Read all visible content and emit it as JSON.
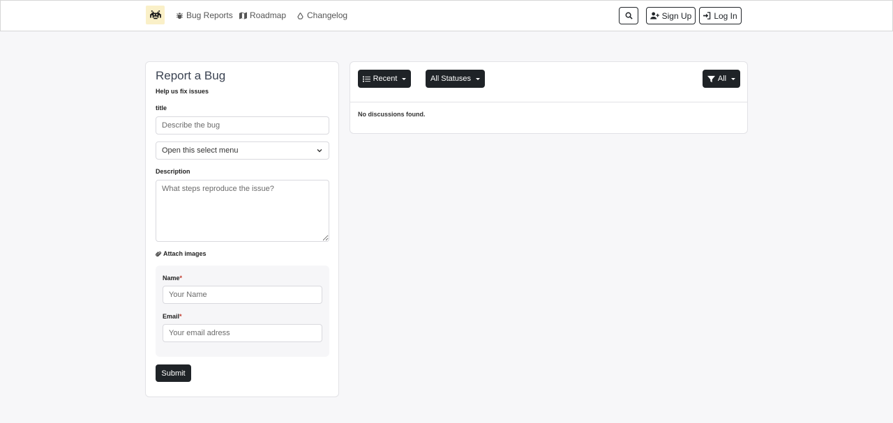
{
  "nav": {
    "links": [
      {
        "label": "Bug Reports",
        "icon": "bug-icon"
      },
      {
        "label": "Roadmap",
        "icon": "map-icon"
      },
      {
        "label": "Changelog",
        "icon": "recycle-icon"
      }
    ],
    "search_icon": "search-icon",
    "signup_label": "Sign Up",
    "login_label": "Log In"
  },
  "form": {
    "title": "Report a Bug",
    "subtitle": "Help us fix issues",
    "title_label": "title",
    "title_placeholder": "Describe the bug",
    "select_value": "Open this select menu",
    "description_label": "Description",
    "description_placeholder": "What steps reproduce the issue?",
    "attach_label": "Attach images",
    "name_label": "Name",
    "name_placeholder": "Your Name",
    "email_label": "Email",
    "email_placeholder": "Your email adress",
    "required_mark": "*",
    "submit_label": "Submit"
  },
  "discussions": {
    "sort_label": "Recent",
    "status_label": "All Statuses",
    "filter_label": "All",
    "empty_message": "No discussions found."
  },
  "colors": {
    "dark_button": "#1f2327",
    "logo_bg": "#faf0c8",
    "page_bg": "#f7f7f9"
  }
}
